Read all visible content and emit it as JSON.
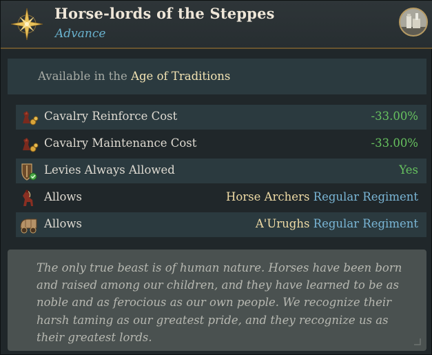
{
  "header": {
    "title": "Horse-lords of the Steppes",
    "subtitle": "Advance",
    "star_icon": "compass-star-icon",
    "portrait_icon": "castle-portrait-icon"
  },
  "availability": {
    "prefix": "Available in the",
    "age": "Age of Traditions"
  },
  "effects": [
    {
      "icon": "cavalry-cost-icon",
      "label": "Cavalry Reinforce Cost",
      "value": "-33.00%"
    },
    {
      "icon": "cavalry-cost-icon",
      "label": "Cavalry Maintenance Cost",
      "value": "-33.00%"
    },
    {
      "icon": "levies-shield-icon",
      "label": "Levies Always Allowed",
      "value": "Yes"
    },
    {
      "icon": "horse-archer-icon",
      "label": "Allows",
      "unit": "Horse Archers",
      "suffix": "Regular Regiment"
    },
    {
      "icon": "wagon-icon",
      "label": "Allows",
      "unit": "A'Urughs",
      "suffix": "Regular Regiment"
    }
  ],
  "flavor_text": "The only true beast is of human nature. Horses have been born and raised among our children, and they have learned to be as noble and as ferocious as our own people. We recognize their harsh taming as our greatest pride, and they recognize us as their greatest lords.",
  "colors": {
    "title": "#eee6d8",
    "subtitle": "#6ab3cf",
    "positive": "#67c25f",
    "unit": "#f0dca6",
    "regiment": "#7ab6d6"
  }
}
